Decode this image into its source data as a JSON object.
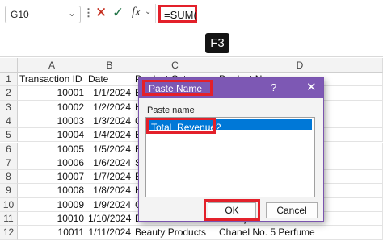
{
  "name_box": {
    "value": "G10"
  },
  "formula_bar": {
    "cancel_icon": "✕",
    "enter_icon": "✓",
    "fx_label": "fx",
    "formula": "=SUM("
  },
  "key_hint": "F3",
  "columns": [
    "A",
    "B",
    "C",
    "D"
  ],
  "rows": [
    {
      "num": "1",
      "a": "Transaction ID",
      "b": "Date",
      "c": "Product Category",
      "d": "Product Name"
    },
    {
      "num": "2",
      "a": "10001",
      "b": "1/1/2024",
      "c": "E",
      "d": ""
    },
    {
      "num": "3",
      "a": "10002",
      "b": "1/2/2024",
      "c": "H",
      "d": ""
    },
    {
      "num": "4",
      "a": "10003",
      "b": "1/3/2024",
      "c": "C",
      "d": ""
    },
    {
      "num": "5",
      "a": "10004",
      "b": "1/4/2024",
      "c": "E",
      "d": ""
    },
    {
      "num": "6",
      "a": "10005",
      "b": "1/5/2024",
      "c": "B",
      "d": "t"
    },
    {
      "num": "7",
      "a": "10006",
      "b": "1/6/2024",
      "c": "S",
      "d": "kball"
    },
    {
      "num": "8",
      "a": "10007",
      "b": "1/7/2024",
      "c": "E",
      "d": ""
    },
    {
      "num": "9",
      "a": "10008",
      "b": "1/8/2024",
      "c": "H",
      "d": ""
    },
    {
      "num": "10",
      "a": "10009",
      "b": "1/9/2024",
      "c": "C",
      "d": ""
    },
    {
      "num": "11",
      "a": "10010",
      "b": "1/10/2024",
      "c": "Books",
      "d": "The by Harrier Baren"
    },
    {
      "num": "12",
      "a": "10011",
      "b": "1/11/2024",
      "c": "Beauty Products",
      "d": "Chanel No. 5 Perfume"
    }
  ],
  "dialog": {
    "title": "Paste Name",
    "help": "?",
    "close": "✕",
    "list_label": "Paste name",
    "items": [
      "Total_Revenue2"
    ],
    "ok_label": "OK",
    "cancel_label": "Cancel"
  }
}
